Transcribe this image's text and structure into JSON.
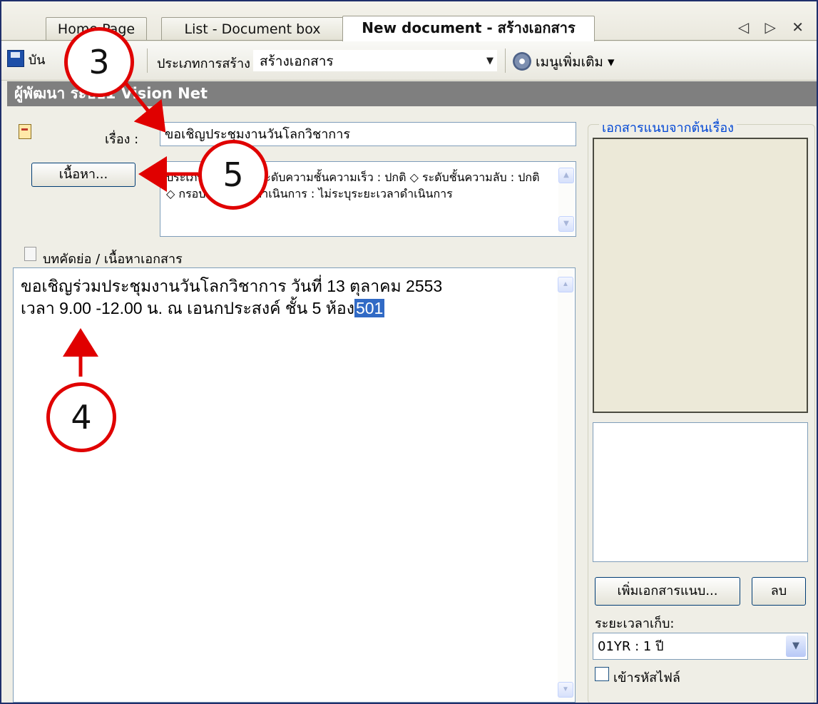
{
  "tabs": [
    {
      "label": "Home Page",
      "active": false
    },
    {
      "label": "List - Document box",
      "active": false
    },
    {
      "label": "New document - สร้างเอกสาร",
      "active": true
    }
  ],
  "tab_nav_label": "◁ ▷ ✕",
  "toolbar": {
    "save_label": "บัน",
    "type_label": "ประเภทการสร้าง",
    "type_value": "สร้างเอกสาร",
    "more_menu_label": "เมนูเพิ่มเติม ▾"
  },
  "author_band": "ผู้พัฒนา ระบบ1 Vision Net",
  "form": {
    "subject_label": "เรื่อง :",
    "subject_value": "ขอเชิญประชุมงานวันโลกวิชาการ",
    "content_button": "เนื้อหา...",
    "properties_text": "ประเภท : ทั่วไป ◇ ระดับความชั้นความเร็ว : ปกติ ◇ ระดับชั้นความลับ : ปกติ ◇ กรอบระยะเวลาดำเนินการ : ไม่ระบุระยะเวลาดำเนินการ",
    "abstract_label": "บทคัดย่อ / เนื้อหาเอกสาร",
    "body_line1": "ขอเชิญร่วมประชุมงานวันโลกวิชาการ วันที่ 13 ตุลาคม 2553",
    "body_line2": "เวลา 9.00 -12.00 น. ณ เอนกประสงค์ ชั้น 5 ห้อง",
    "body_selected": "501"
  },
  "attachments": {
    "title": "เอกสารแนบจากต้นเรื่อง",
    "add_button": "เพิ่มเอกสารแนบ...",
    "delete_button": "ลบ",
    "retention_label": "ระยะเวลาเก็บ:",
    "retention_value": "01YR : 1 ปี",
    "encrypt_label": "เข้ารหัสไฟล์"
  },
  "annotations": [
    "3",
    "4",
    "5"
  ],
  "colors": {
    "annotation": "#e00000",
    "band": "#7f7f7f",
    "link_blue": "#0046d5",
    "selection": "#316ac5"
  }
}
